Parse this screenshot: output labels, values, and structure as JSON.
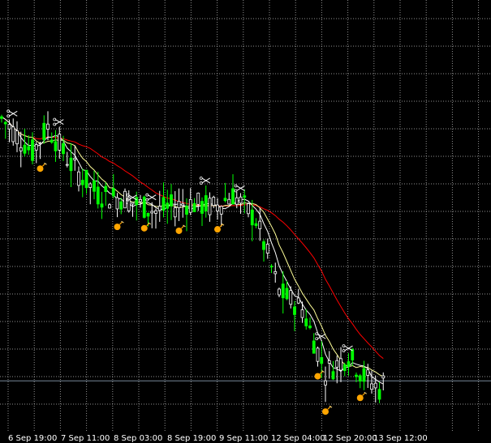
{
  "colors": {
    "background": "#000000",
    "grid": "#c0c0c0",
    "bull_candle": "#00ff00",
    "bear_candle": "#ffffff",
    "ma_slow": "#ff0000",
    "ma_mid": "#ffff99",
    "ma_fast": "#ffffff",
    "bid_line": "#778899",
    "signal_marker": "#ffa500"
  },
  "chart_data": {
    "type": "candlestick",
    "title": "",
    "xlabel": "",
    "ylabel": "",
    "grid": true,
    "x_tick_labels": [
      "6 Sep 19:00",
      "7 Sep 11:00",
      "8 Sep 03:00",
      "8 Sep 19:00",
      "9 Sep 11:00",
      "12 Sep 04:00",
      "12 Sep 20:00",
      "13 Sep 12:00"
    ],
    "bid_line_level": 0.12,
    "candles": [],
    "moving_averages": [
      {
        "color": "#ff0000",
        "values": []
      },
      {
        "color": "#ffff99",
        "values": []
      },
      {
        "color": "#ffffff",
        "values": []
      }
    ],
    "signal_markers": [
      {
        "kind": "up",
        "icon": "bomb-icon",
        "index": 10
      },
      {
        "kind": "up",
        "icon": "bomb-icon",
        "index": 30
      },
      {
        "kind": "up",
        "icon": "bomb-icon",
        "index": 37
      },
      {
        "kind": "up",
        "icon": "bomb-icon",
        "index": 46
      },
      {
        "kind": "up",
        "icon": "bomb-icon",
        "index": 56
      },
      {
        "kind": "up",
        "icon": "bomb-icon",
        "index": 82
      },
      {
        "kind": "up",
        "icon": "bomb-icon",
        "index": 84
      },
      {
        "kind": "up",
        "icon": "bomb-icon",
        "index": 93
      },
      {
        "kind": "exit",
        "icon": "scissors-icon",
        "index": 3
      },
      {
        "kind": "exit",
        "icon": "scissors-icon",
        "index": 15
      },
      {
        "kind": "exit",
        "icon": "scissors-icon",
        "index": 34
      },
      {
        "kind": "exit",
        "icon": "scissors-icon",
        "index": 39
      },
      {
        "kind": "exit",
        "icon": "scissors-icon",
        "index": 53
      },
      {
        "kind": "exit",
        "icon": "scissors-icon",
        "index": 62
      },
      {
        "kind": "exit",
        "icon": "scissors-icon",
        "index": 83
      },
      {
        "kind": "exit",
        "icon": "scissors-icon",
        "index": 90
      }
    ]
  }
}
